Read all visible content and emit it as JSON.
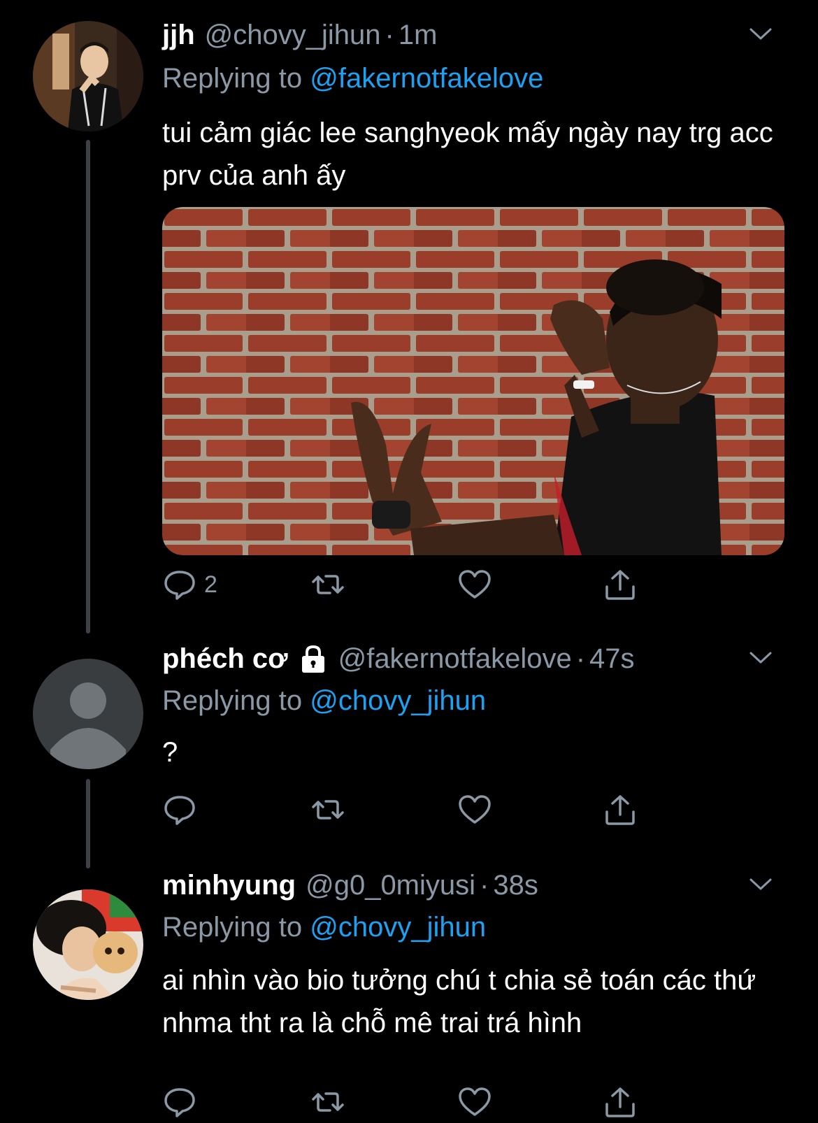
{
  "tweets": [
    {
      "name": "jjh",
      "handle": "@chovy_jihun",
      "dot": "·",
      "time": "1m",
      "replying_prefix": "Replying to ",
      "replying_to": "@fakernotfakelove",
      "text": "tui cảm giác lee sanghyeok mấy ngày nay trg acc prv của anh ấy",
      "reply_count": "2",
      "has_media": true,
      "protected": false
    },
    {
      "name": "phéch cơ",
      "handle": "@fakernotfakelove",
      "dot": "·",
      "time": "47s",
      "replying_prefix": "Replying to ",
      "replying_to": "@chovy_jihun",
      "text": "?",
      "reply_count": "",
      "has_media": false,
      "protected": true
    },
    {
      "name": "minhyung",
      "handle": "@g0_0miyusi",
      "dot": "·",
      "time": "38s",
      "replying_prefix": "Replying to ",
      "replying_to": "@chovy_jihun",
      "text": "ai nhìn vào bio tưởng chú t chia sẻ toán các thứ nhma tht ra là chỗ mê trai trá hình",
      "reply_count": "",
      "has_media": false,
      "protected": false
    }
  ],
  "icons": {
    "reply": "speech-bubble-icon",
    "retweet": "retweet-icon",
    "like": "heart-icon",
    "share": "share-icon",
    "menu": "chevron-down-icon",
    "lock": "lock-icon"
  },
  "colors": {
    "background": "#000000",
    "secondary_text": "#8b98a5",
    "mention": "#1da1f2",
    "thread_line": "#3d4145"
  }
}
